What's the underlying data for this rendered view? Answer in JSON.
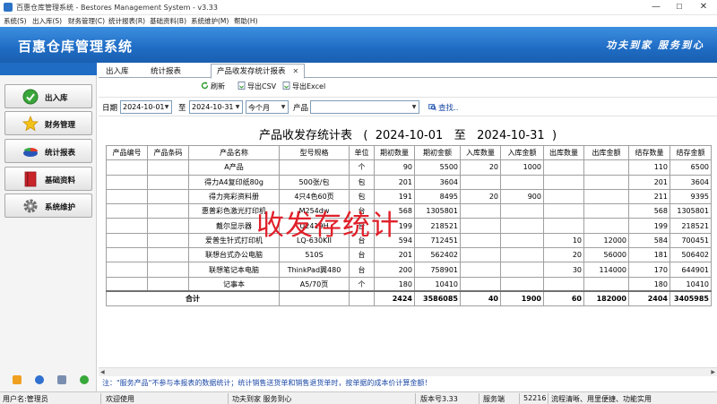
{
  "window": {
    "title": "百惠仓库管理系统 - Bestores Management System - v3.33",
    "minimize": "—",
    "maximize": "☐",
    "close": "✕"
  },
  "menu": [
    "系统(S)",
    "出入库(S)",
    "财务管理(C)",
    "统计报表(R)",
    "基础资料(B)",
    "系统维护(M)",
    "帮助(H)"
  ],
  "banner": {
    "title": "百惠仓库管理系统",
    "slogan": "功夫到家 服务到心"
  },
  "sidebar": {
    "items": [
      {
        "label": "出入库",
        "icon": "check-circle-icon"
      },
      {
        "label": "财务管理",
        "icon": "star-icon"
      },
      {
        "label": "统计报表",
        "icon": "pie-chart-icon"
      },
      {
        "label": "基础资料",
        "icon": "book-icon"
      },
      {
        "label": "系统维护",
        "icon": "gear-icon"
      }
    ]
  },
  "tabs": [
    {
      "label": "出入库"
    },
    {
      "label": "统计报表"
    },
    {
      "label": "产品收发存统计报表",
      "close": "✕"
    }
  ],
  "toolbar": {
    "refresh": "刷新",
    "export_csv": "导出CSV",
    "export_excel": "导出Excel"
  },
  "filter": {
    "date_label": "日期",
    "date_from": "2024-10-01",
    "to_label": "至",
    "date_to": "2024-10-31",
    "period": "今个月",
    "product_label": "产品",
    "product_value": "",
    "search": "查找.."
  },
  "report": {
    "title": "产品收发存统计表",
    "range_open": "(",
    "date_from": "2024-10-01",
    "to": "至",
    "date_to": "2024-10-31",
    "range_close": ")",
    "columns": [
      "产品编号",
      "产品条码",
      "产品名称",
      "型号规格",
      "单位",
      "期初数量",
      "期初金额",
      "入库数量",
      "入库金额",
      "出库数量",
      "出库金额",
      "结存数量",
      "结存金额"
    ],
    "rows": [
      [
        "",
        "",
        "A产品",
        "",
        "个",
        "90",
        "5500",
        "20",
        "1000",
        "",
        "",
        "110",
        "6500"
      ],
      [
        "",
        "",
        "得力A4复印纸80g",
        "500张/包",
        "包",
        "201",
        "3604",
        "",
        "",
        "",
        "",
        "201",
        "3604"
      ],
      [
        "",
        "",
        "得力亮彩资料册",
        "4只4色60页",
        "包",
        "191",
        "8495",
        "20",
        "900",
        "",
        "",
        "211",
        "9395"
      ],
      [
        "",
        "",
        "惠普彩色激光打印机",
        "M254dw",
        "台",
        "568",
        "1305801",
        "",
        "",
        "",
        "",
        "568",
        "1305801"
      ],
      [
        "",
        "",
        "戴尔显示器",
        "U2419H",
        "台",
        "199",
        "218521",
        "",
        "",
        "",
        "",
        "199",
        "218521"
      ],
      [
        "",
        "",
        "爱普生针式打印机",
        "LQ-630KII",
        "台",
        "594",
        "712451",
        "",
        "",
        "10",
        "12000",
        "584",
        "700451"
      ],
      [
        "",
        "",
        "联想台式办公电脑",
        "510S",
        "台",
        "201",
        "562402",
        "",
        "",
        "20",
        "56000",
        "181",
        "506402"
      ],
      [
        "",
        "",
        "联想笔记本电脑",
        "ThinkPad翼480",
        "台",
        "200",
        "758901",
        "",
        "",
        "30",
        "114000",
        "170",
        "644901"
      ],
      [
        "",
        "",
        "记事本",
        "A5/70页",
        "个",
        "180",
        "10410",
        "",
        "",
        "",
        "",
        "180",
        "10410"
      ]
    ],
    "total": [
      "合计",
      "",
      "",
      "2424",
      "3586085",
      "40",
      "1900",
      "60",
      "182000",
      "2404",
      "3405985"
    ]
  },
  "overlay": "收发存统计",
  "note": "注：\"服务产品\"不参与本报表的数据统计；统计销售送货单和销售退货单时，按单据的成本价计算金额！",
  "status": {
    "user": "用户名:管理员",
    "welcome": "欢迎使用",
    "slogan": "功夫到家 服务到心",
    "version": "版本号3.33",
    "server_label": "服务端",
    "server_port": "52216",
    "tagline": "流程清晰、用里便捷、功能实用"
  },
  "colors": {
    "banner": "#1f6cc4",
    "link": "#1a47a6",
    "overlay": "#e0202a"
  }
}
